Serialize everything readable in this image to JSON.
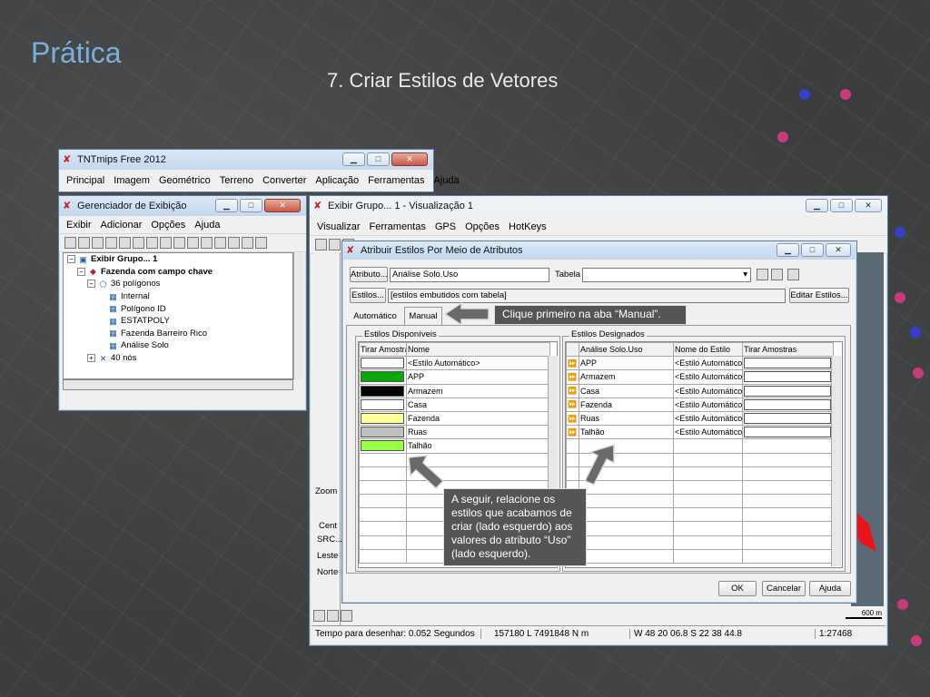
{
  "slide": {
    "title": "Prática",
    "subtitle": "7. Criar Estilos de Vetores"
  },
  "tntmips": {
    "title": "TNTmips Free 2012",
    "menu": [
      "Principal",
      "Imagem",
      "Geométrico",
      "Terreno",
      "Converter",
      "Aplicação",
      "Ferramentas",
      "Ajuda"
    ]
  },
  "gerenciador": {
    "title": "Gerenciador de Exibição",
    "menu": [
      "Exibir",
      "Adicionar",
      "Opções",
      "Ajuda"
    ],
    "tree": [
      {
        "label": "Exibir Grupo... 1",
        "indent": 0,
        "toggle": "−",
        "bold": true,
        "icon": "group-icon"
      },
      {
        "label": "Fazenda com campo chave",
        "indent": 1,
        "toggle": "−",
        "bold": true,
        "icon": "vector-layer-icon"
      },
      {
        "label": "36 polígonos",
        "indent": 2,
        "toggle": "−",
        "bold": false,
        "icon": "polygon-icon"
      },
      {
        "label": "Internal",
        "indent": 3,
        "toggle": "",
        "bold": false,
        "icon": "table-icon"
      },
      {
        "label": "Polígono ID",
        "indent": 3,
        "toggle": "",
        "bold": false,
        "icon": "table-icon"
      },
      {
        "label": "ESTATPOLY",
        "indent": 3,
        "toggle": "",
        "bold": false,
        "icon": "table-icon"
      },
      {
        "label": "Fazenda Barreiro Rico",
        "indent": 3,
        "toggle": "",
        "bold": false,
        "icon": "table-icon"
      },
      {
        "label": "Análise Solo",
        "indent": 3,
        "toggle": "",
        "bold": false,
        "icon": "table-icon"
      },
      {
        "label": "40 nós",
        "indent": 2,
        "toggle": "+",
        "bold": false,
        "icon": "node-icon"
      }
    ]
  },
  "visualizacao": {
    "title": "Exibir Grupo... 1 - Visualização 1",
    "menu": [
      "Visualizar",
      "Ferramentas",
      "GPS",
      "Opções",
      "HotKeys"
    ],
    "side_labels": [
      "Zoom",
      "Cent",
      "SRC...",
      "Leste",
      "Norte"
    ],
    "status": {
      "draw_time": "Tempo para desenhar: 0.052 Segundos",
      "coords": "157180 L 7491848 N m",
      "geo": "W 48 20 06.8  S 22 38 44.8",
      "scale": "1:27468",
      "scalebar": "600 m"
    }
  },
  "dialog": {
    "title": "Atribuir Estilos Por Meio de Atributos",
    "atributo_button": "Atributo...",
    "atributo_value": "Análise Solo.Uso",
    "tabela_label": "Tabela",
    "estilos_button": "Estilos...",
    "estilos_value": "[estilos embutidos com tabela]",
    "editar_button": "Editar Estilos...",
    "tabs": [
      "Automático",
      "Manual"
    ],
    "available_group": "Estilos Disponíveis",
    "available_headers": [
      "Tirar Amostras",
      "Nome"
    ],
    "available_rows": [
      {
        "color": "#ffffff",
        "name": "<Estilo Automático>"
      },
      {
        "color": "#08a808",
        "name": "APP"
      },
      {
        "color": "#000000",
        "name": "Armazem"
      },
      {
        "color": "#ffffff",
        "name": "Casa"
      },
      {
        "color": "#ffff99",
        "name": "Fazenda"
      },
      {
        "color": "#c0c0c0",
        "name": "Ruas"
      },
      {
        "color": "#99ff44",
        "name": "Talhão"
      }
    ],
    "assigned_group": "Estilos Designados",
    "assigned_headers": [
      "Análise Solo.Uso",
      "Nome do Estilo",
      "Tirar Amostras"
    ],
    "assigned_rows": [
      {
        "value": "APP",
        "style": "<Estilo Automático>"
      },
      {
        "value": "Armazem",
        "style": "<Estilo Automático>"
      },
      {
        "value": "Casa",
        "style": "<Estilo Automático>"
      },
      {
        "value": "Fazenda",
        "style": "<Estilo Automático>"
      },
      {
        "value": "Ruas",
        "style": "<Estilo Automático>"
      },
      {
        "value": "Talhão",
        "style": "<Estilo Automático>"
      }
    ],
    "ok": "OK",
    "cancel": "Cancelar",
    "help": "Ajuda"
  },
  "callouts": {
    "manual": "Clique primeiro na aba “Manual”.",
    "relate": "A seguir, relacione os estilos que acabamos de criar (lado esquerdo) aos valores do atributo “Uso” (lado esquerdo)."
  },
  "colors": {
    "title_blue": "#7aaee0",
    "callout_bg": "#555555",
    "map_red": "#e8141a"
  }
}
